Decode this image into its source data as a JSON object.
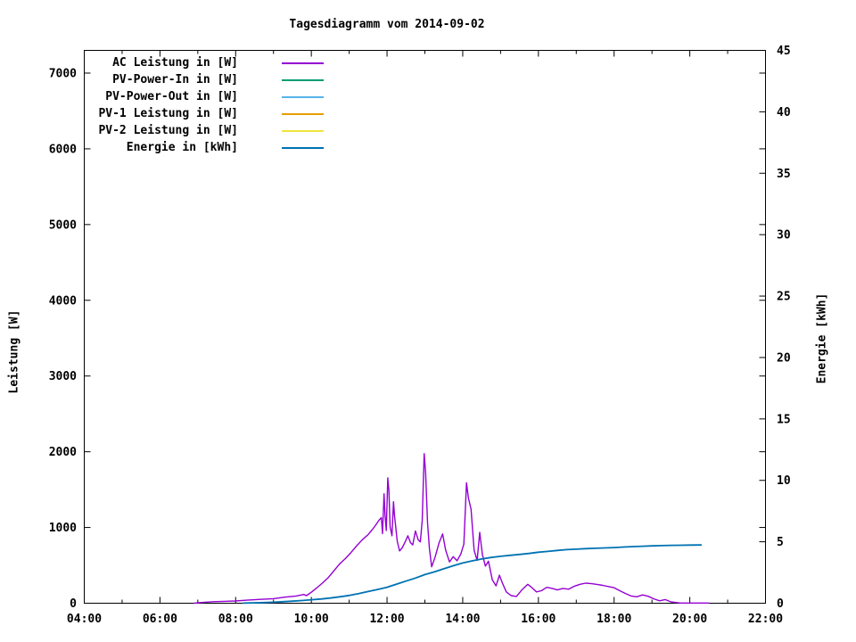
{
  "window": {
    "background": "#ffffff",
    "text_color": "#000000"
  },
  "chart_data": {
    "type": "line",
    "title": "Tagesdiagramm vom 2014-09-02",
    "xlabel": "",
    "ylabel": "Leistung [W]",
    "y2label": "Energie [kWh]",
    "x_unit": "time_of_day_hours",
    "xlim": [
      4,
      22
    ],
    "ylim_left": [
      0,
      7300
    ],
    "ylim_right": [
      0,
      45
    ],
    "x_major_tick_labels": [
      "04:00",
      "06:00",
      "08:00",
      "10:00",
      "12:00",
      "14:00",
      "16:00",
      "18:00",
      "20:00",
      "22:00"
    ],
    "x_major_step_hours": 2,
    "x_minor_step_hours": 1,
    "y_left_ticks": [
      0,
      1000,
      2000,
      3000,
      4000,
      5000,
      6000,
      7000
    ],
    "y_right_ticks": [
      0,
      5,
      10,
      15,
      20,
      25,
      30,
      35,
      40,
      45
    ],
    "grid": false,
    "legend_position": "top-left-inside",
    "series": [
      {
        "name": "AC Leistung in [W]",
        "color": "#9400d3",
        "axis": "left",
        "stroke_width": 1.4,
        "points": [
          [
            6.9,
            0
          ],
          [
            7.1,
            10
          ],
          [
            7.4,
            20
          ],
          [
            7.7,
            25
          ],
          [
            8.0,
            30
          ],
          [
            8.3,
            40
          ],
          [
            8.6,
            50
          ],
          [
            9.0,
            60
          ],
          [
            9.3,
            80
          ],
          [
            9.6,
            95
          ],
          [
            9.8,
            115
          ],
          [
            9.87,
            100
          ],
          [
            10.0,
            145
          ],
          [
            10.15,
            205
          ],
          [
            10.3,
            270
          ],
          [
            10.45,
            340
          ],
          [
            10.6,
            430
          ],
          [
            10.75,
            520
          ],
          [
            10.9,
            590
          ],
          [
            11.05,
            670
          ],
          [
            11.2,
            760
          ],
          [
            11.35,
            840
          ],
          [
            11.5,
            905
          ],
          [
            11.6,
            965
          ],
          [
            11.7,
            1030
          ],
          [
            11.78,
            1090
          ],
          [
            11.85,
            1130
          ],
          [
            11.88,
            920
          ],
          [
            11.92,
            1445
          ],
          [
            11.95,
            1150
          ],
          [
            11.98,
            960
          ],
          [
            12.02,
            1655
          ],
          [
            12.05,
            1480
          ],
          [
            12.08,
            1010
          ],
          [
            12.13,
            890
          ],
          [
            12.17,
            1340
          ],
          [
            12.2,
            1150
          ],
          [
            12.27,
            820
          ],
          [
            12.33,
            690
          ],
          [
            12.4,
            730
          ],
          [
            12.48,
            810
          ],
          [
            12.55,
            890
          ],
          [
            12.62,
            800
          ],
          [
            12.68,
            770
          ],
          [
            12.75,
            955
          ],
          [
            12.82,
            840
          ],
          [
            12.88,
            810
          ],
          [
            12.93,
            1090
          ],
          [
            12.98,
            1975
          ],
          [
            13.02,
            1730
          ],
          [
            13.07,
            1060
          ],
          [
            13.12,
            720
          ],
          [
            13.18,
            480
          ],
          [
            13.27,
            610
          ],
          [
            13.37,
            790
          ],
          [
            13.47,
            915
          ],
          [
            13.55,
            700
          ],
          [
            13.65,
            545
          ],
          [
            13.75,
            615
          ],
          [
            13.85,
            560
          ],
          [
            13.95,
            650
          ],
          [
            14.03,
            780
          ],
          [
            14.1,
            1590
          ],
          [
            14.15,
            1390
          ],
          [
            14.22,
            1240
          ],
          [
            14.3,
            700
          ],
          [
            14.38,
            565
          ],
          [
            14.45,
            935
          ],
          [
            14.52,
            640
          ],
          [
            14.6,
            490
          ],
          [
            14.68,
            555
          ],
          [
            14.78,
            310
          ],
          [
            14.88,
            230
          ],
          [
            14.97,
            370
          ],
          [
            15.05,
            265
          ],
          [
            15.15,
            150
          ],
          [
            15.28,
            100
          ],
          [
            15.42,
            90
          ],
          [
            15.57,
            180
          ],
          [
            15.72,
            250
          ],
          [
            15.83,
            205
          ],
          [
            15.95,
            150
          ],
          [
            16.08,
            165
          ],
          [
            16.22,
            210
          ],
          [
            16.37,
            195
          ],
          [
            16.5,
            175
          ],
          [
            16.65,
            195
          ],
          [
            16.8,
            185
          ],
          [
            16.95,
            225
          ],
          [
            17.1,
            250
          ],
          [
            17.25,
            265
          ],
          [
            17.4,
            258
          ],
          [
            17.55,
            248
          ],
          [
            17.7,
            235
          ],
          [
            17.85,
            220
          ],
          [
            18.0,
            205
          ],
          [
            18.15,
            165
          ],
          [
            18.3,
            128
          ],
          [
            18.45,
            95
          ],
          [
            18.6,
            85
          ],
          [
            18.75,
            110
          ],
          [
            18.9,
            92
          ],
          [
            19.05,
            58
          ],
          [
            19.2,
            32
          ],
          [
            19.35,
            48
          ],
          [
            19.5,
            18
          ],
          [
            19.65,
            8
          ],
          [
            19.75,
            2
          ],
          [
            20.5,
            2
          ]
        ]
      },
      {
        "name": "PV-Power-In in [W]",
        "color": "#009e73",
        "axis": "left",
        "stroke_width": 1.4,
        "points": []
      },
      {
        "name": "PV-Power-Out in [W]",
        "color": "#56b4e9",
        "axis": "left",
        "stroke_width": 1.4,
        "points": []
      },
      {
        "name": "PV-1 Leistung in [W]",
        "color": "#e69f00",
        "axis": "left",
        "stroke_width": 1.4,
        "points": []
      },
      {
        "name": "PV-2 Leistung in [W]",
        "color": "#f0e442",
        "axis": "left",
        "stroke_width": 1.4,
        "points": []
      },
      {
        "name": "Energie in [kWh]",
        "color": "#0072b2",
        "axis": "right",
        "stroke_width": 1.8,
        "points": [
          [
            8.2,
            0.01
          ],
          [
            8.75,
            0.05
          ],
          [
            9.0,
            0.08
          ],
          [
            9.25,
            0.12
          ],
          [
            9.5,
            0.17
          ],
          [
            9.75,
            0.22
          ],
          [
            10.0,
            0.28
          ],
          [
            10.25,
            0.34
          ],
          [
            10.5,
            0.42
          ],
          [
            10.75,
            0.52
          ],
          [
            11.0,
            0.63
          ],
          [
            11.25,
            0.78
          ],
          [
            11.5,
            0.95
          ],
          [
            11.75,
            1.12
          ],
          [
            12.0,
            1.3
          ],
          [
            12.25,
            1.55
          ],
          [
            12.5,
            1.8
          ],
          [
            12.75,
            2.05
          ],
          [
            13.0,
            2.33
          ],
          [
            13.25,
            2.55
          ],
          [
            13.5,
            2.8
          ],
          [
            13.75,
            3.05
          ],
          [
            14.0,
            3.27
          ],
          [
            14.25,
            3.45
          ],
          [
            14.5,
            3.6
          ],
          [
            14.75,
            3.72
          ],
          [
            15.0,
            3.82
          ],
          [
            15.25,
            3.9
          ],
          [
            15.5,
            3.97
          ],
          [
            15.75,
            4.05
          ],
          [
            16.0,
            4.15
          ],
          [
            16.25,
            4.22
          ],
          [
            16.5,
            4.3
          ],
          [
            16.75,
            4.36
          ],
          [
            17.0,
            4.4
          ],
          [
            17.25,
            4.44
          ],
          [
            17.5,
            4.47
          ],
          [
            17.75,
            4.5
          ],
          [
            18.0,
            4.53
          ],
          [
            18.25,
            4.57
          ],
          [
            18.5,
            4.61
          ],
          [
            18.75,
            4.64
          ],
          [
            19.0,
            4.67
          ],
          [
            19.25,
            4.69
          ],
          [
            19.5,
            4.71
          ],
          [
            19.75,
            4.72
          ],
          [
            20.0,
            4.73
          ],
          [
            20.3,
            4.74
          ]
        ]
      }
    ]
  }
}
